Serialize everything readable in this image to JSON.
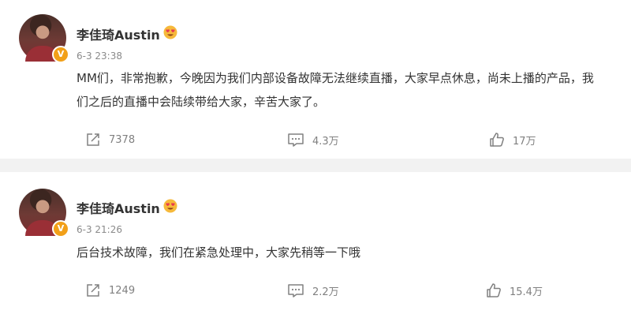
{
  "colors": {
    "page_bg": "#f2f2f2",
    "card_bg": "#ffffff",
    "badge_orange": "#f2a019",
    "meta_gray": "#8a8a8a"
  },
  "posts": [
    {
      "author": "李佳琦Austin",
      "verified_icon": "verified-v-icon",
      "member_icon": "heart-eyes-emoji-icon",
      "time": "6-3 23:38",
      "text": "MM们，非常抱歉，今晚因为我们内部设备故障无法继续直播，大家早点休息，尚未上播的产品，我们之后的直播中会陆续带给大家，辛苦大家了。",
      "repost_count": "7378",
      "comment_count": "4.3万",
      "like_count": "17万"
    },
    {
      "author": "李佳琦Austin",
      "verified_icon": "verified-v-icon",
      "member_icon": "heart-eyes-emoji-icon",
      "time": "6-3 21:26",
      "text": "后台技术故障，我们在紧急处理中，大家先稍等一下哦",
      "repost_count": "1249",
      "comment_count": "2.2万",
      "like_count": "15.4万"
    }
  ]
}
